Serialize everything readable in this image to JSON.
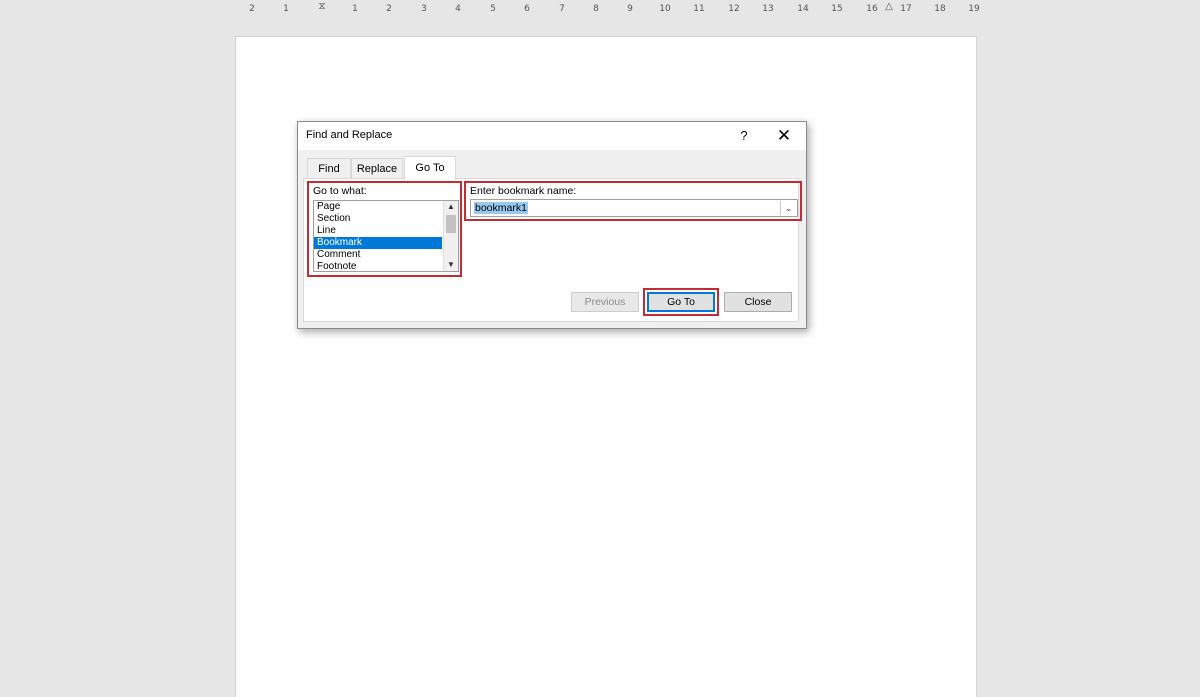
{
  "ruler": {
    "labels": [
      "2",
      "1",
      "",
      "1",
      "2",
      "3",
      "4",
      "5",
      "6",
      "7",
      "8",
      "9",
      "10",
      "11",
      "12",
      "13",
      "14",
      "15",
      "16",
      "17",
      "18",
      "19"
    ]
  },
  "dialog": {
    "title": "Find and Replace",
    "help_label": "?",
    "close_label": "✕",
    "tabs": [
      {
        "label": "Find",
        "active": false
      },
      {
        "label": "Replace",
        "active": false
      },
      {
        "label": "Go To",
        "active": true
      }
    ],
    "goto_what_label": "Go to what:",
    "goto_items": [
      "Page",
      "Section",
      "Line",
      "Bookmark",
      "Comment",
      "Footnote"
    ],
    "selected_item": "Bookmark",
    "bookmark_label": "Enter bookmark name:",
    "bookmark_value": "bookmark1",
    "buttons": {
      "previous": "Previous",
      "goto": "Go To",
      "close": "Close"
    }
  },
  "colors": {
    "highlight_border": "#c42b35",
    "selection": "#0078d7",
    "text_selection": "#99c9ef"
  }
}
